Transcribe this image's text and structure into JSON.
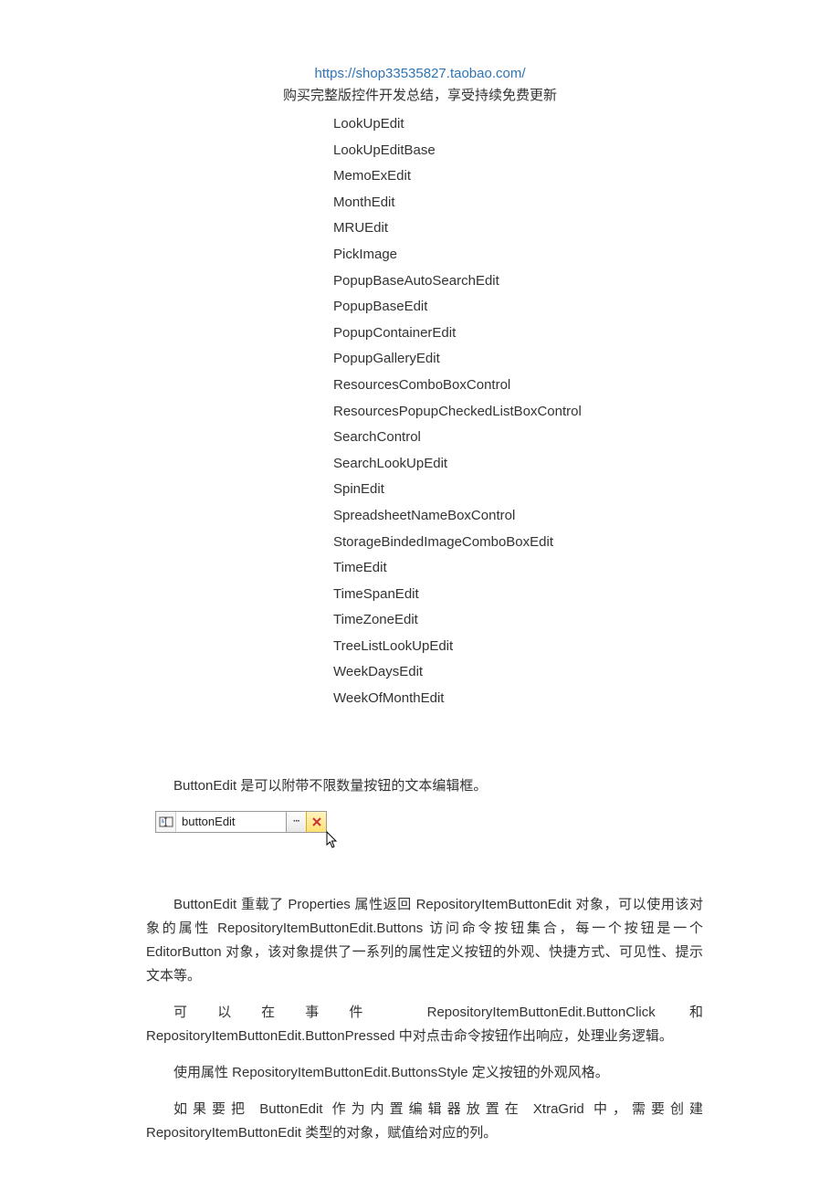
{
  "header": {
    "link": "https://shop33535827.taobao.com/",
    "subtitle": "购买完整版控件开发总结，享受持续免费更新"
  },
  "list": [
    "LookUpEdit",
    "LookUpEditBase",
    "MemoExEdit",
    "MonthEdit",
    "MRUEdit",
    "PickImage",
    "PopupBaseAutoSearchEdit",
    "PopupBaseEdit",
    "PopupContainerEdit",
    "PopupGalleryEdit",
    "ResourcesComboBoxControl",
    "ResourcesPopupCheckedListBoxControl",
    "SearchControl",
    "SearchLookUpEdit",
    "SpinEdit",
    "SpreadsheetNameBoxControl",
    "StorageBindedImageComboBoxEdit",
    "TimeEdit",
    "TimeSpanEdit",
    "TimeZoneEdit",
    "TreeListLookUpEdit",
    "WeekDaysEdit",
    "WeekOfMonthEdit"
  ],
  "buttonedit": {
    "text_value": "buttonEdit",
    "ellipsis_label": "···"
  },
  "paragraphs": {
    "p1": "ButtonEdit 是可以附带不限数量按钮的文本编辑框。",
    "p2": "ButtonEdit 重载了 Properties 属性返回 RepositoryItemButtonEdit 对象，可以使用该对象的属性 RepositoryItemButtonEdit.Buttons 访问命令按钮集合，每一个按钮是一个 EditorButton 对象，该对象提供了一系列的属性定义按钮的外观、快捷方式、可见性、提示文本等。",
    "p3": "可以在事件 RepositoryItemButtonEdit.ButtonClick 和 RepositoryItemButtonEdit.ButtonPressed 中对点击命令按钮作出响应，处理业务逻辑。",
    "p4": "使用属性 RepositoryItemButtonEdit.ButtonsStyle 定义按钮的外观风格。",
    "p5": "如果要把 ButtonEdit 作为内置编辑器放置在 XtraGrid 中，需要创建 RepositoryItemButtonEdit 类型的对象，赋值给对应的列。"
  }
}
